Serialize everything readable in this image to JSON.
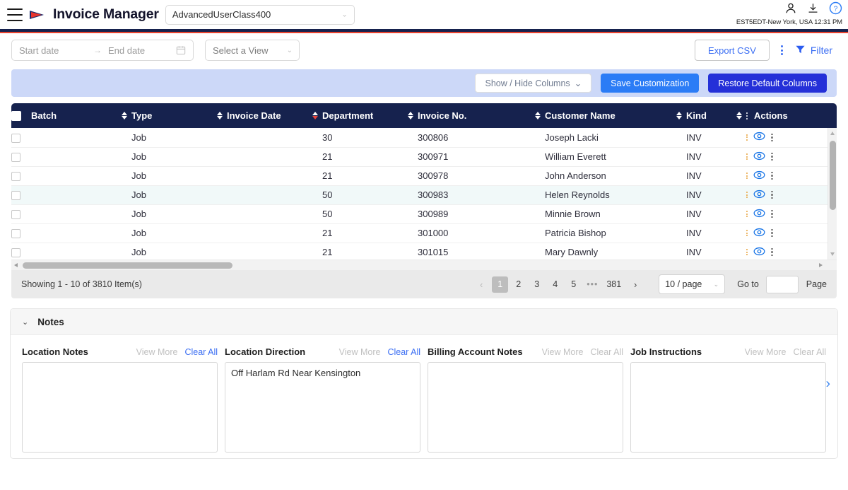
{
  "app": {
    "title": "Invoice Manager",
    "user_class": "AdvancedUserClass400",
    "timezone_clock": "EST5EDT-New York, USA 12:31 PM"
  },
  "toolbar": {
    "start_date_placeholder": "Start date",
    "range_arrow": "→",
    "end_date_placeholder": "End date",
    "view_select_label": "Select a View",
    "export_label": "Export CSV",
    "filter_label": "Filter"
  },
  "customization": {
    "show_hide_label": "Show / Hide Columns",
    "save_label": "Save Customization",
    "restore_label": "Restore Default Columns"
  },
  "table": {
    "columns": [
      {
        "label": "Batch",
        "sorted": false
      },
      {
        "label": "Type",
        "sorted": false
      },
      {
        "label": "Invoice Date",
        "sorted": true
      },
      {
        "label": "Department",
        "sorted": false
      },
      {
        "label": "Invoice No.",
        "sorted": false
      },
      {
        "label": "Customer Name",
        "sorted": false
      },
      {
        "label": "Kind",
        "sorted": false
      },
      {
        "label": "Actions",
        "sorted": false
      }
    ],
    "rows": [
      {
        "batch": "",
        "type": "Job",
        "invoice_date": "",
        "department": "30",
        "invoice_no": "300806",
        "customer_name": "Joseph Lacki",
        "kind": "INV",
        "highlighted": false
      },
      {
        "batch": "",
        "type": "Job",
        "invoice_date": "",
        "department": "21",
        "invoice_no": "300971",
        "customer_name": "William Everett",
        "kind": "INV",
        "highlighted": false
      },
      {
        "batch": "",
        "type": "Job",
        "invoice_date": "",
        "department": "21",
        "invoice_no": "300978",
        "customer_name": "John Anderson",
        "kind": "INV",
        "highlighted": false
      },
      {
        "batch": "",
        "type": "Job",
        "invoice_date": "",
        "department": "50",
        "invoice_no": "300983",
        "customer_name": "Helen Reynolds",
        "kind": "INV",
        "highlighted": true
      },
      {
        "batch": "",
        "type": "Job",
        "invoice_date": "",
        "department": "50",
        "invoice_no": "300989",
        "customer_name": "Minnie Brown",
        "kind": "INV",
        "highlighted": false
      },
      {
        "batch": "",
        "type": "Job",
        "invoice_date": "",
        "department": "21",
        "invoice_no": "301000",
        "customer_name": "Patricia Bishop",
        "kind": "INV",
        "highlighted": false
      },
      {
        "batch": "",
        "type": "Job",
        "invoice_date": "",
        "department": "21",
        "invoice_no": "301015",
        "customer_name": "Mary Dawnly",
        "kind": "INV",
        "highlighted": false
      }
    ]
  },
  "pagination": {
    "showing": "Showing 1 - 10 of 3810 Item(s)",
    "prev_arrow": "‹",
    "next_arrow": "›",
    "pages": [
      "1",
      "2",
      "3",
      "4",
      "5"
    ],
    "ellipsis": "•••",
    "last_page": "381",
    "active_page": "1",
    "per_page": "10 / page",
    "goto_label": "Go to",
    "goto_value": "",
    "page_label": "Page"
  },
  "notes": {
    "section_title": "Notes",
    "next_arrow": "›",
    "columns": [
      {
        "title": "Location Notes",
        "view_more": "View More",
        "clear_all": "Clear All",
        "clear_enabled": true,
        "value": ""
      },
      {
        "title": "Location Direction",
        "view_more": "View More",
        "clear_all": "Clear All",
        "clear_enabled": true,
        "value": "Off Harlam Rd Near Kensington"
      },
      {
        "title": "Billing Account Notes",
        "view_more": "View More",
        "clear_all": "Clear All",
        "clear_enabled": false,
        "value": ""
      },
      {
        "title": "Job Instructions",
        "view_more": "View More",
        "clear_all": "Clear All",
        "clear_enabled": false,
        "value": ""
      }
    ]
  },
  "colors": {
    "navy": "#16224e",
    "red": "#e8432f",
    "accent_blue": "#3b6ef3",
    "button_blue": "#2b7cf6",
    "button_darkblue": "#2430d8",
    "customization_bar": "#ccd8f8",
    "row_highlight": "#f1f9f9"
  }
}
